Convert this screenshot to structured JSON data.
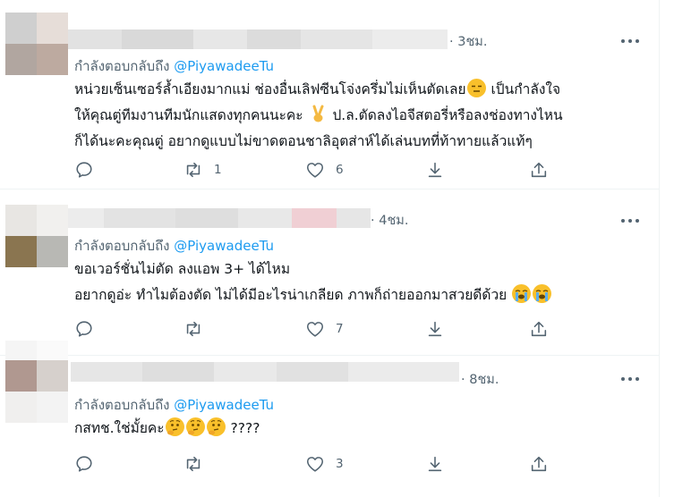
{
  "tweets": [
    {
      "time": "3ชม.",
      "meta_prefix": "· ",
      "reply_prefix": "กำลังตอบกลับถึง",
      "reply_handle": "@PiyawadeeTu",
      "line1_a": "หน่วยเซ็นเซอร์ล้ำเอียงมากแม่ ช่องอื่นเลิฟซีนโจ่งครึ่มไม่เห็นตัดเลย",
      "line1_b": " เป็นกำลังใจ",
      "line2_a": "ให้คุณตู่ทีมงานทีมนักแสดงทุกคนนะคะ ",
      "line2_b": " ป.ล.ตัดลงไอจีสตอรี่หรือลงช่องทางไหน",
      "line3": "ก็ได้นะคะคุณตู่ อยากดูแบบไม่ขาดตอนชาลิอุตส่าห์ได้เล่นบทที่ท้าทายแล้วแท้ๆ",
      "emoji_1": "expressionless-face",
      "emoji_2": "victory-hand",
      "replies": "",
      "retweets": "1",
      "likes": "6"
    },
    {
      "time": "4ชม.",
      "meta_prefix": "· ",
      "reply_prefix": "กำลังตอบกลับถึง",
      "reply_handle": "@PiyawadeeTu",
      "line1": "ขอเวอร์ชั่นไม่ตัด ลงแอพ 3+ ได้ไหม",
      "line2": "อยากดูอ่ะ ทำไมต้องตัด ไม่ได้มีอะไรน่าเกลียด ภาพก็ถ่ายออกมาสวยดีด้วย",
      "emoji": "loudly-crying-face",
      "replies": "",
      "retweets": "",
      "likes": "7"
    },
    {
      "time": "8ชม.",
      "meta_prefix": "· ",
      "reply_prefix": "กำลังตอบกลับถึง",
      "reply_handle": "@PiyawadeeTu",
      "line1_a": "กสทช.ใช่มั้ยคะ",
      "line1_b": " ????",
      "emoji": "thinking-face",
      "replies": "",
      "retweets": "",
      "likes": "3"
    }
  ]
}
